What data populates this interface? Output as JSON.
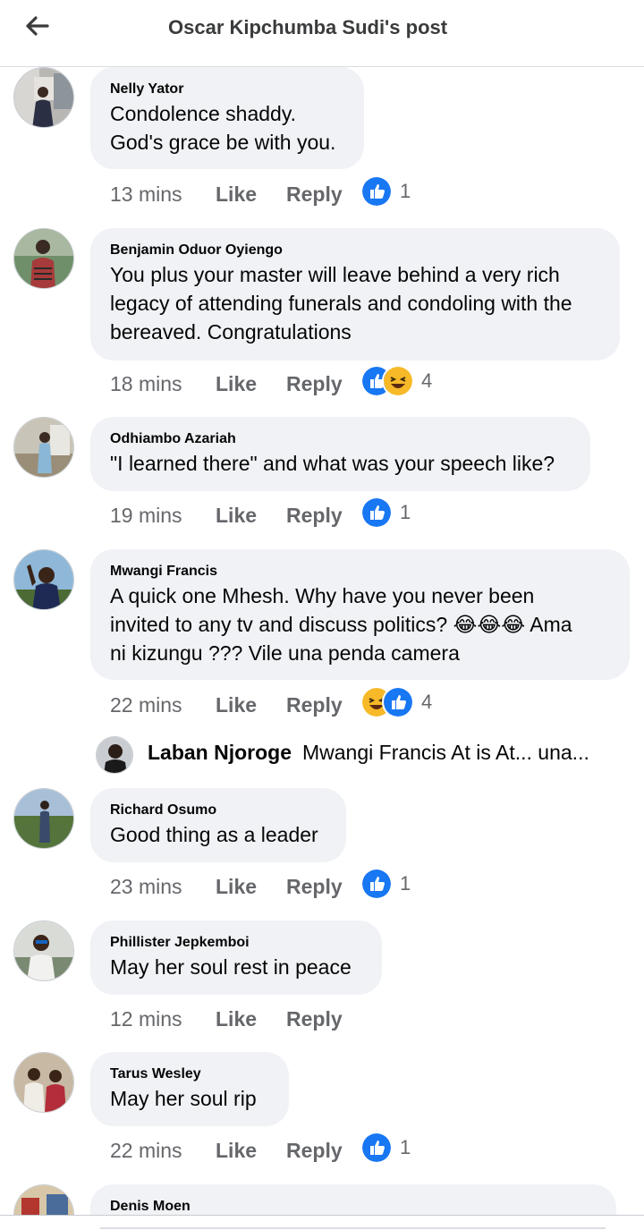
{
  "header": {
    "title": "Oscar Kipchumba Sudi's post"
  },
  "actions": {
    "like_label": "Like",
    "reply_label": "Reply"
  },
  "colors": {
    "like_blue": "#1877f2",
    "haha_yellow": "#f7b928",
    "meta_gray": "#65676b",
    "bubble_bg": "#f0f2f5"
  },
  "comments": [
    {
      "author": "Nelly Yator",
      "lines": [
        "Condolence shaddy.",
        "God's grace be with you."
      ],
      "time": "13 mins",
      "reactions": [
        "like"
      ],
      "count": "1"
    },
    {
      "author": "Benjamin Oduor Oyiengo",
      "lines": [
        "You plus your master will leave behind a very rich",
        "legacy of attending funerals and condoling with the",
        "bereaved. Congratulations"
      ],
      "time": "18 mins",
      "reactions": [
        "like",
        "haha"
      ],
      "count": "4"
    },
    {
      "author": "Odhiambo Azariah",
      "lines": [
        "\"I learned there\" and what was your speech like?"
      ],
      "time": "19 mins",
      "reactions": [
        "like"
      ],
      "count": "1"
    },
    {
      "author": "Mwangi Francis",
      "lines": [
        "A quick one Mhesh. Why have you never been",
        "invited to any tv and discuss politics? 😂😂😂 Ama",
        "ni kizungu ??? Vile una penda camera"
      ],
      "time": "22 mins",
      "reactions": [
        "haha",
        "like"
      ],
      "count": "4",
      "reply": {
        "author": "Laban Njoroge",
        "text": "Mwangi Francis At is At... una..."
      }
    },
    {
      "author": "Richard Osumo",
      "lines": [
        "Good thing as a leader"
      ],
      "time": "23 mins",
      "reactions": [
        "like"
      ],
      "count": "1"
    },
    {
      "author": "Phillister Jepkemboi",
      "lines": [
        "May her soul rest in peace"
      ],
      "time": "12 mins",
      "reactions": [],
      "count": ""
    },
    {
      "author": "Tarus Wesley",
      "lines": [
        "May her soul rip"
      ],
      "time": "22 mins",
      "reactions": [
        "like"
      ],
      "count": "1"
    },
    {
      "author": "Denis Moen",
      "lines": [],
      "time": "",
      "reactions": [],
      "count": ""
    }
  ]
}
